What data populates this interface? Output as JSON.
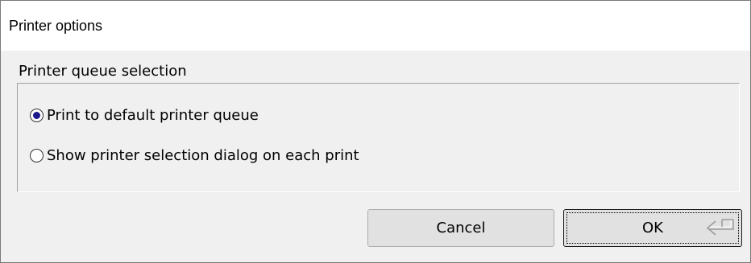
{
  "window": {
    "title": "Printer options"
  },
  "group": {
    "label": "Printer queue selection",
    "options": [
      {
        "label": "Print to default printer queue",
        "selected": true
      },
      {
        "label": "Show printer selection dialog on each print",
        "selected": false
      }
    ]
  },
  "buttons": {
    "cancel_label": "Cancel",
    "ok_label": "OK",
    "ok_icon": "enter-key-icon"
  },
  "colors": {
    "dialog_bg": "#f0f0f0",
    "titlebar_bg": "#ffffff",
    "radio_dot": "#1a1a8c",
    "button_bg": "#e1e1e1"
  }
}
